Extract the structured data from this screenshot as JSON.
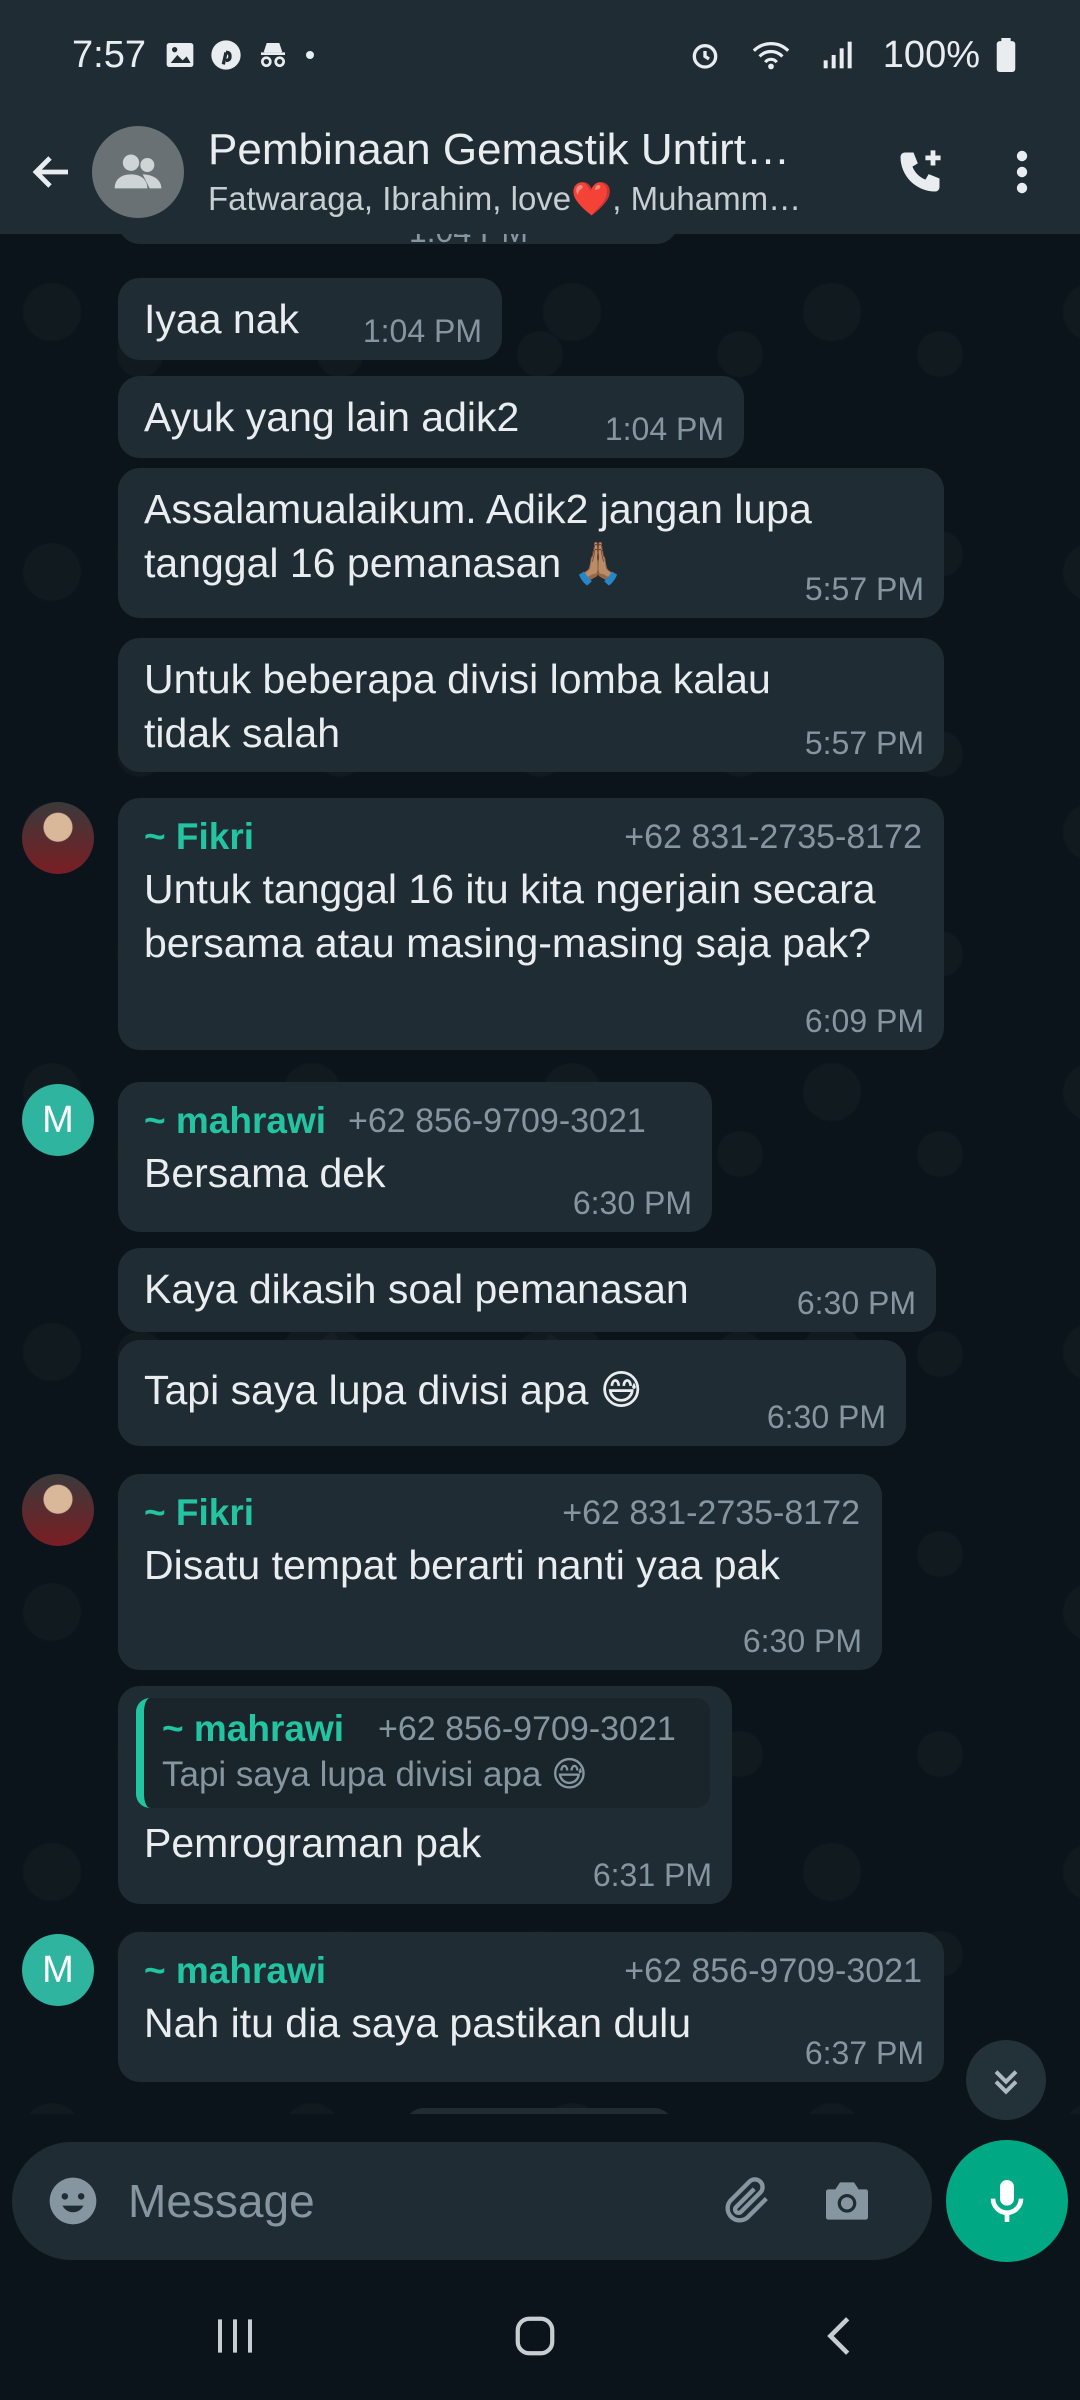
{
  "status_bar": {
    "time": "7:57",
    "icons": [
      "gallery-icon",
      "pinterest-icon",
      "incognito-icon",
      "dot-icon"
    ],
    "right_icons": [
      "alarm-icon",
      "wifi-icon",
      "signal-icon"
    ],
    "battery": "100%"
  },
  "header": {
    "title": "Pembinaan Gemastik Untirt…",
    "members": "Fatwaraga, Ibrahim, love❤️, Muhamm…",
    "accent": "#23c4a2"
  },
  "messages": [
    {
      "text": "Iyaa nak",
      "time": "1:04 PM"
    },
    {
      "text": "Ayuk yang lain adik2",
      "time": "1:04 PM"
    },
    {
      "text": "Assalamualaikum. Adik2 jangan lupa tanggal 16 pemanasan 🙏🏽",
      "time": "5:57 PM"
    },
    {
      "text": "Untuk beberapa divisi lomba kalau tidak salah",
      "time": "5:57 PM"
    },
    {
      "sender": "~ Fikri",
      "phone": "+62 831-2735-8172",
      "text": "Untuk tanggal 16 itu kita ngerjain secara bersama atau masing-masing saja pak?",
      "time": "6:09 PM"
    },
    {
      "sender": "~ mahrawi",
      "phone": "+62 856-9709-3021",
      "text": "Bersama dek",
      "time": "6:30 PM"
    },
    {
      "text": "Kaya dikasih soal pemanasan",
      "time": "6:30 PM"
    },
    {
      "text": "Tapi saya lupa divisi apa 😅",
      "time": "6:30 PM"
    },
    {
      "sender": "~ Fikri",
      "phone": "+62 831-2735-8172",
      "text": "Disatu tempat berarti nanti yaa pak",
      "time": "6:30 PM"
    },
    {
      "quote_sender": "~ mahrawi",
      "quote_phone": "+62 856-9709-3021",
      "quote_text": "Tapi saya lupa divisi apa 😅",
      "text": "Pemrograman pak",
      "time": "6:31 PM"
    },
    {
      "sender": "~ mahrawi",
      "phone": "+62 856-9709-3021",
      "text": "Nah itu dia saya pastikan dulu",
      "time": "6:37 PM"
    }
  ],
  "avatar_letter": "M",
  "partial_time_top": "1:04 PM",
  "input": {
    "placeholder": "Message"
  }
}
